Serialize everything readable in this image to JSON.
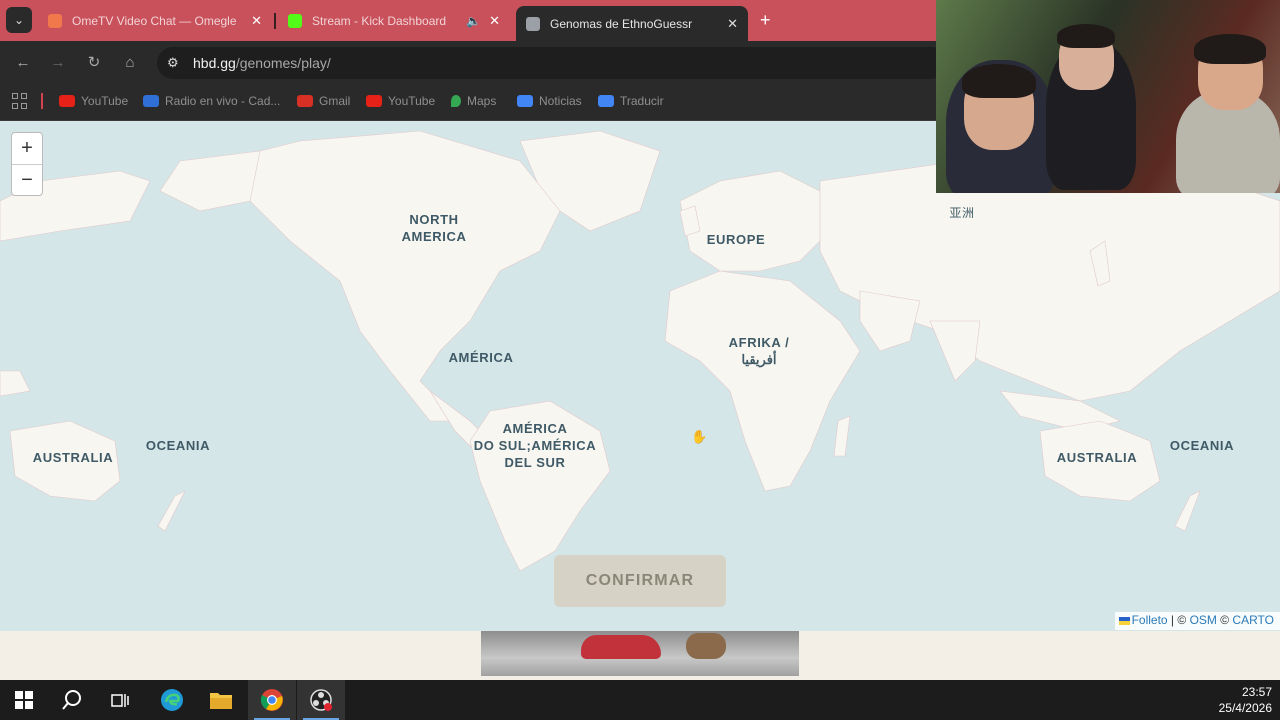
{
  "browser": {
    "tabs": [
      {
        "title": "OmeTV Video Chat — Omegle",
        "favicon_color": "#f0784a",
        "active": false
      },
      {
        "title": "Stream - Kick Dashboard",
        "favicon_color": "#53fc18",
        "active": false
      },
      {
        "title": "Genomas de EthnoGuessr",
        "favicon_color": "#9aa0a6",
        "active": true
      }
    ],
    "close_glyph": "✕",
    "new_tab_glyph": "+",
    "speaker_glyph": "🔈",
    "url_host": "hbd.gg",
    "url_path": "/genomes/play/",
    "bookmarks": [
      {
        "label": "YouTube",
        "icon": "youtube-icon",
        "color": "#e62117"
      },
      {
        "label": "Radio en vivo - Cad...",
        "icon": "radio-icon",
        "color": "#2f6fd6"
      },
      {
        "label": "Gmail",
        "icon": "gmail-icon",
        "color": "#d93025"
      },
      {
        "label": "YouTube",
        "icon": "youtube-icon",
        "color": "#e62117"
      },
      {
        "label": "Maps",
        "icon": "maps-icon",
        "color": "#34a853"
      },
      {
        "label": "Noticias",
        "icon": "news-icon",
        "color": "#4285f4"
      },
      {
        "label": "Traducir",
        "icon": "translate-icon",
        "color": "#4285f4"
      }
    ]
  },
  "map": {
    "zoom_in": "+",
    "zoom_out": "−",
    "labels": {
      "north_america": "NORTH\nAMERICA",
      "europe": "EUROPE",
      "america": "AMÉRICA",
      "afrika": "AFRIKA /\nأفريقيا",
      "south_america": "AMÉRICA\nDO SUL;AMÉRICA\nDEL SUR",
      "oceania_left": "OCEANIA",
      "australia_left": "AUSTRALIA",
      "australia_right": "AUSTRALIA",
      "oceania_right": "OCEANIA",
      "asia_cjk": "亚洲"
    },
    "confirm_label": "CONFIRMAR",
    "attribution": {
      "leaflet": "Folleto",
      "sep1": " | © ",
      "osm": "OSM",
      "sep2": " © ",
      "carto": "CARTO"
    }
  },
  "taskbar": {
    "time": "23:57",
    "date": "25/4/2026",
    "accent": "#6aa5e6"
  }
}
